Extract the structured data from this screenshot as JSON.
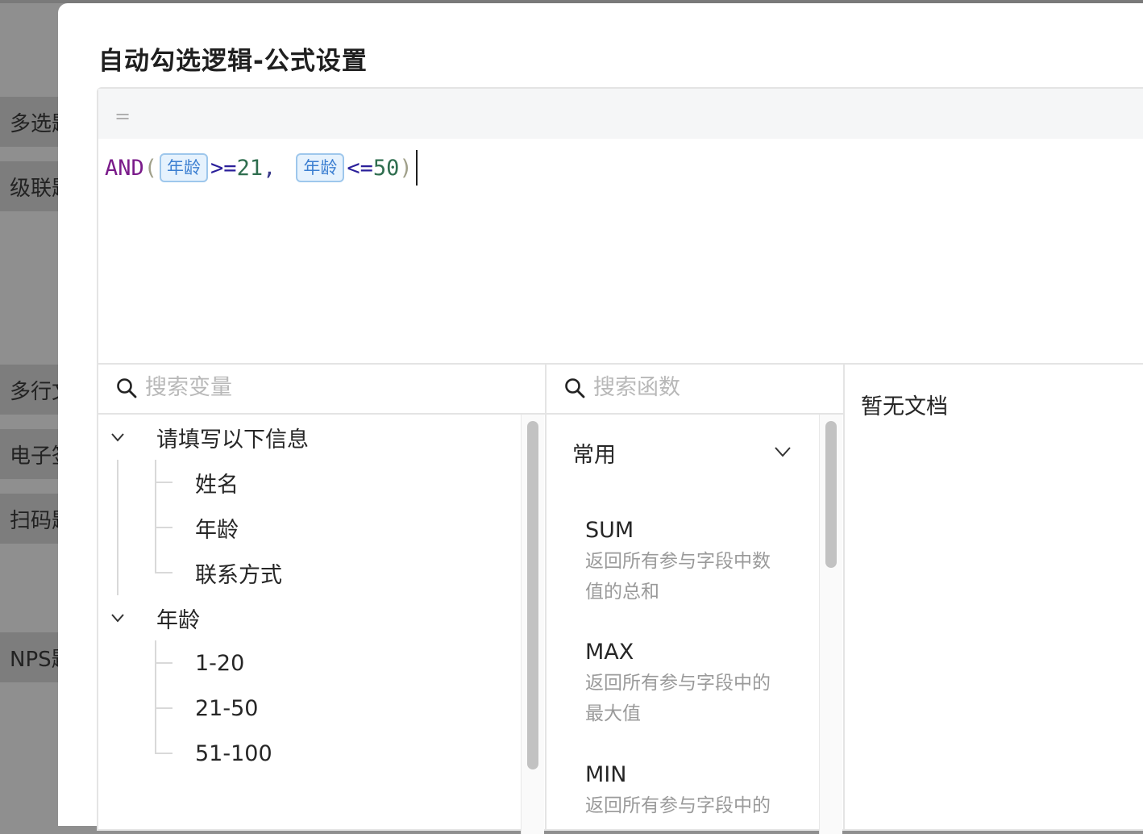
{
  "background": {
    "items": [
      "多选题",
      "级联题",
      "多行文本",
      "电子签名",
      "扫码题",
      "NPS题"
    ]
  },
  "modal": {
    "title": "自动勾选逻辑-公式设置"
  },
  "editor": {
    "eq_sign": "=",
    "formula": {
      "fn": "AND",
      "open": "(",
      "var1": "年龄",
      "op1": ">=",
      "num1": "21",
      "comma": ",",
      "var2": "年龄",
      "op2": "<=",
      "num2": "50",
      "close": ")"
    }
  },
  "variables": {
    "search_placeholder": "搜索变量",
    "groups": [
      {
        "label": "请填写以下信息",
        "children": [
          "姓名",
          "年龄",
          "联系方式"
        ]
      },
      {
        "label": "年龄",
        "children": [
          "1-20",
          "21-50",
          "51-100"
        ]
      }
    ]
  },
  "functions": {
    "search_placeholder": "搜索函数",
    "category": "常用",
    "items": [
      {
        "name": "SUM",
        "desc_line1": "返回所有参与字段中数",
        "desc_line2": "值的总和"
      },
      {
        "name": "MAX",
        "desc_line1": "返回所有参与字段中的",
        "desc_line2": "最大值"
      },
      {
        "name": "MIN",
        "desc_line1": "返回所有参与字段中的",
        "desc_line2": ""
      }
    ]
  },
  "doc": {
    "empty_text": "暂无文档"
  }
}
